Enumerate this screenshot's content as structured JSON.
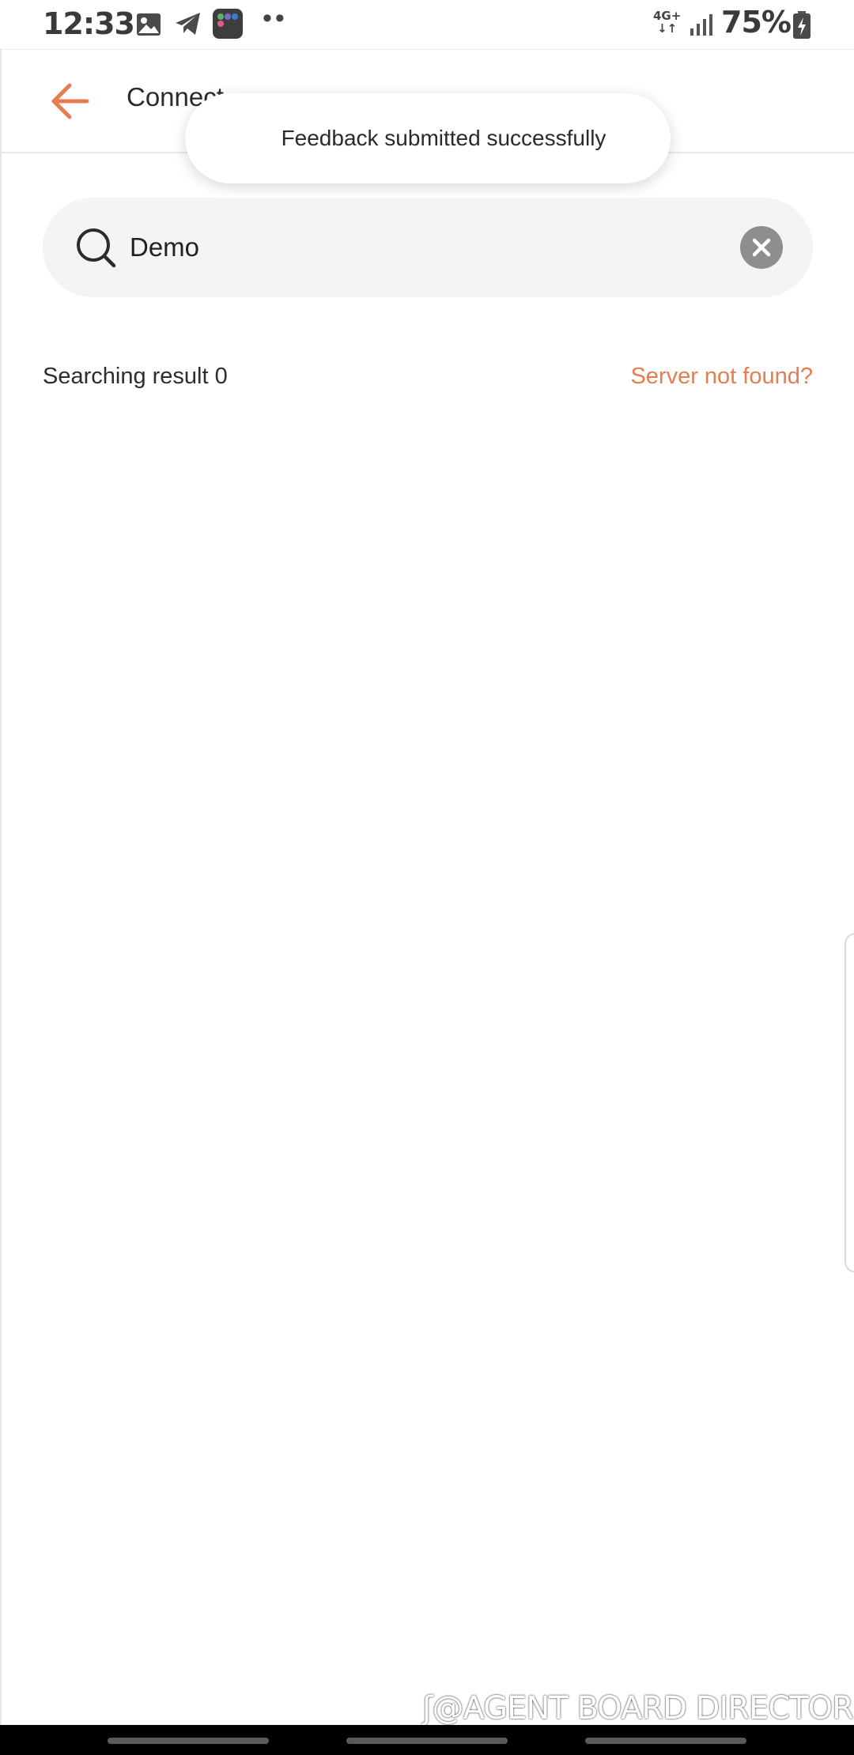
{
  "status_bar": {
    "time": "12:33",
    "network_top": "4G+",
    "network_bottom": "↓↑",
    "battery_percent": "75%",
    "overflow_dots": "••",
    "icons": [
      "image-icon",
      "telegram-icon",
      "app-folder-icon",
      "signal-icon",
      "battery-charging-icon"
    ]
  },
  "app_bar": {
    "title": "Connect",
    "back_icon": "arrow-left-icon"
  },
  "toast": {
    "message": "Feedback submitted successfully"
  },
  "search": {
    "value": "Demo",
    "icon": "search-icon",
    "clear_icon": "clear-icon"
  },
  "results": {
    "count_label": "Searching result 0",
    "server_link": "Server not found?"
  },
  "watermark": {
    "text": "@AGENT BOARD DIRECTOR"
  },
  "colors": {
    "accent": "#e57d4e",
    "search_bg": "#f3f4f6",
    "clear_button": "#8e8e8e",
    "nav_bg": "#000000"
  }
}
